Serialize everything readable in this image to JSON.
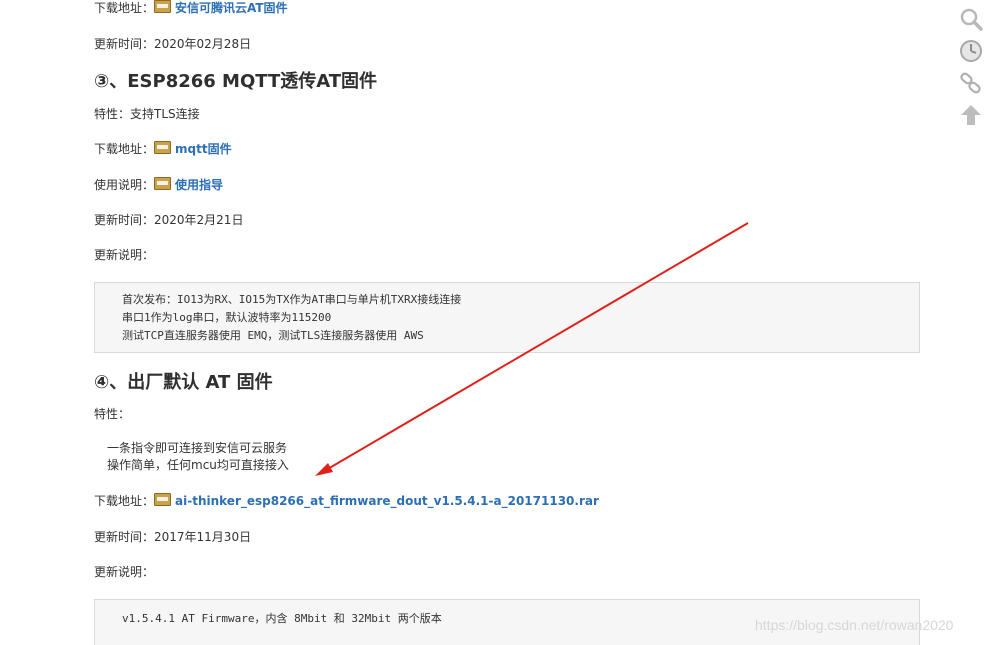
{
  "section_top": {
    "download_label": "下载地址：",
    "download_link": "安信可腾讯云AT固件",
    "update_time": "更新时间：2020年02月28日"
  },
  "section3": {
    "heading": "③、ESP8266 MQTT透传AT固件",
    "feature": "特性：支持TLS连接",
    "download_label": "下载地址：",
    "download_link": "mqtt固件",
    "usage_label": "使用说明：",
    "usage_link": "使用指导",
    "update_time": "更新时间：2020年2月21日",
    "notes_label": "更新说明：",
    "notes": [
      "首次发布：IO13为RX、IO15为TX作为AT串口与单片机TXRX接线连接",
      "串口1作为log串口，默认波特率为115200",
      "测试TCP直连服务器使用 EMQ，测试TLS连接服务器使用 AWS"
    ]
  },
  "section4": {
    "heading": "④、出厂默认 AT 固件",
    "feature_label": "特性：",
    "features": [
      "一条指令即可连接到安信可云服务",
      "操作简单，任何mcu均可直接接入"
    ],
    "download_label": "下载地址：",
    "download_link": "ai-thinker_esp8266_at_firmware_dout_v1.5.4.1-a_20171130.rar",
    "update_time": "更新时间：2017年11月30日",
    "notes_label": "更新说明：",
    "notes": [
      "v1.5.4.1 AT Firmware，内含 8Mbit 和 32Mbit 两个版本"
    ]
  },
  "tools": [
    "search-icon",
    "clock-icon",
    "link-icon",
    "arrow-up-icon"
  ],
  "watermark": "https://blog.csdn.net/rowan2020",
  "colors": {
    "link": "#2c6fb5",
    "arrow": "#e0201a",
    "code_bg": "#f6f6f6"
  }
}
